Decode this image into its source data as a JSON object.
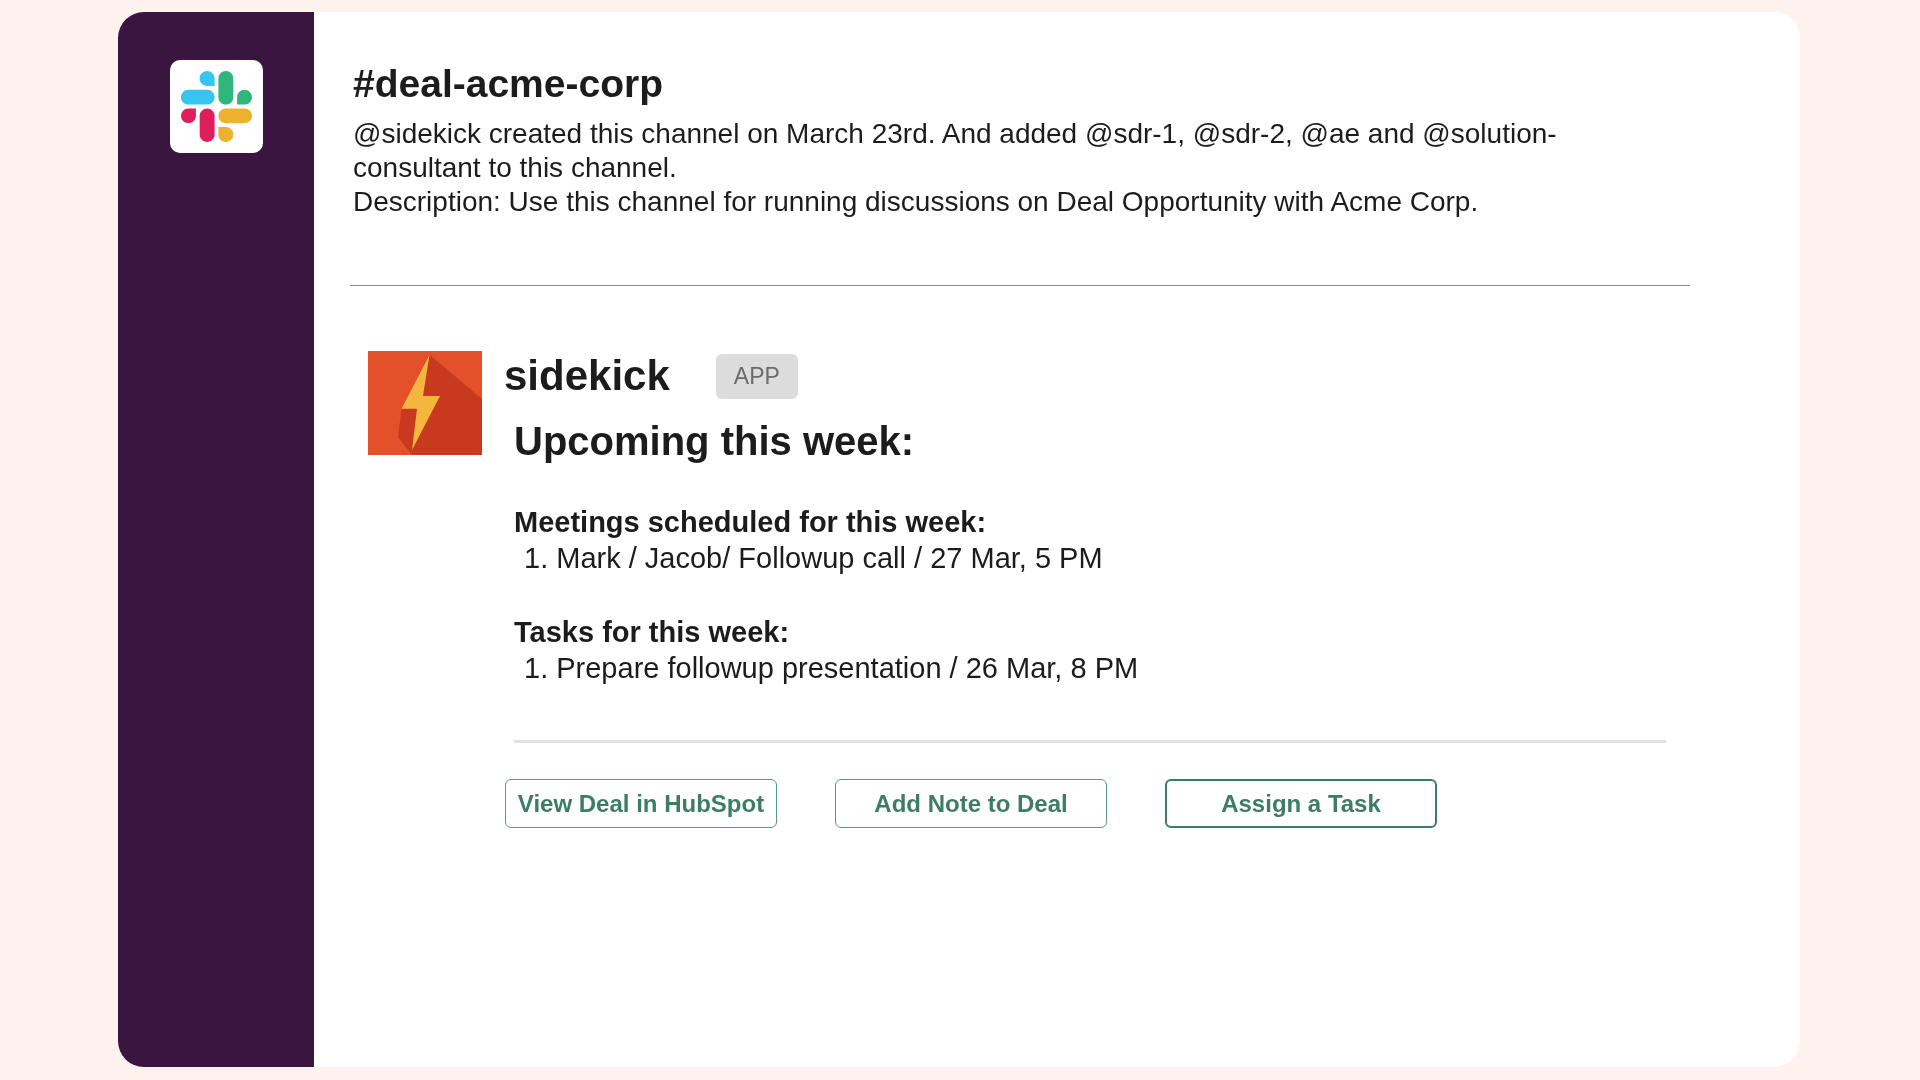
{
  "channel": {
    "name": "#deal-acme-corp",
    "intro": "@sidekick created this channel on March 23rd. And added @sdr-1, @sdr-2, @ae and @solution-consultant to this channel.",
    "description": "Description: Use this channel for running discussions on Deal Opportunity with Acme Corp."
  },
  "message": {
    "sender": "sidekick",
    "badge": "APP",
    "heading": "Upcoming this week:",
    "sections": [
      {
        "title": "Meetings scheduled for this week:",
        "items": [
          "1. Mark / Jacob/ Followup call / 27 Mar, 5 PM"
        ]
      },
      {
        "title": "Tasks for this week:",
        "items": [
          "1. Prepare followup presentation / 26 Mar, 8 PM"
        ]
      }
    ],
    "actions": [
      {
        "label": "View Deal in HubSpot",
        "focused": false
      },
      {
        "label": "Add Note to Deal",
        "focused": false
      },
      {
        "label": "Assign a Task",
        "focused": true
      }
    ]
  }
}
